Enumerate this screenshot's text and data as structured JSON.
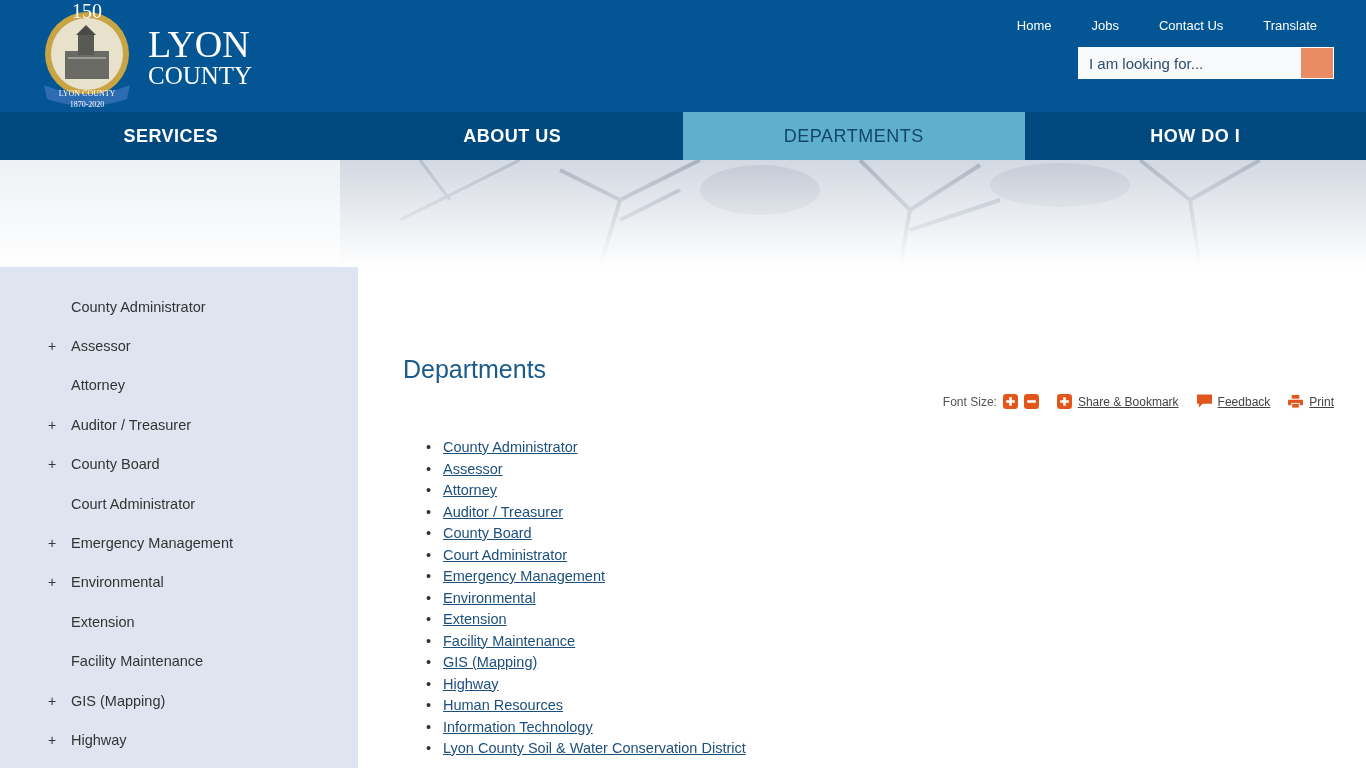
{
  "logo": {
    "seal_number": "150",
    "seal_ribbon": "LYON COUNTY",
    "seal_years": "1870-2020",
    "name_line1": "LYON",
    "name_line2": "COUNTY"
  },
  "top_links": [
    "Home",
    "Jobs",
    "Contact Us",
    "Translate"
  ],
  "search": {
    "placeholder": "I am looking for..."
  },
  "nav": [
    {
      "label": "SERVICES",
      "selected": false
    },
    {
      "label": "ABOUT US",
      "selected": false
    },
    {
      "label": "DEPARTMENTS",
      "selected": true
    },
    {
      "label": "HOW DO I",
      "selected": false
    }
  ],
  "sidebar": {
    "items": [
      {
        "label": "County Administrator",
        "expandable": false
      },
      {
        "label": "Assessor",
        "expandable": true
      },
      {
        "label": "Attorney",
        "expandable": false
      },
      {
        "label": "Auditor / Treasurer",
        "expandable": true
      },
      {
        "label": "County Board",
        "expandable": true
      },
      {
        "label": "Court Administrator",
        "expandable": false
      },
      {
        "label": "Emergency Management",
        "expandable": true
      },
      {
        "label": "Environmental",
        "expandable": true
      },
      {
        "label": "Extension",
        "expandable": false
      },
      {
        "label": "Facility Maintenance",
        "expandable": false
      },
      {
        "label": "GIS (Mapping)",
        "expandable": true
      },
      {
        "label": "Highway",
        "expandable": true
      }
    ],
    "expand_symbol": "+"
  },
  "page": {
    "title": "Departments",
    "toolbar": {
      "font_size_label": "Font Size:",
      "share": "Share & Bookmark",
      "feedback": "Feedback",
      "print": "Print"
    },
    "bullet": "•",
    "links": [
      "County Administrator",
      "Assessor",
      "Attorney",
      "Auditor / Treasurer",
      "County Board",
      "Court Administrator",
      "Emergency Management",
      "Environmental",
      "Extension",
      "Facility Maintenance",
      "GIS (Mapping)",
      "Highway",
      "Human Resources",
      "Information Technology",
      "Lyon County Soil & Water Conservation District"
    ]
  }
}
